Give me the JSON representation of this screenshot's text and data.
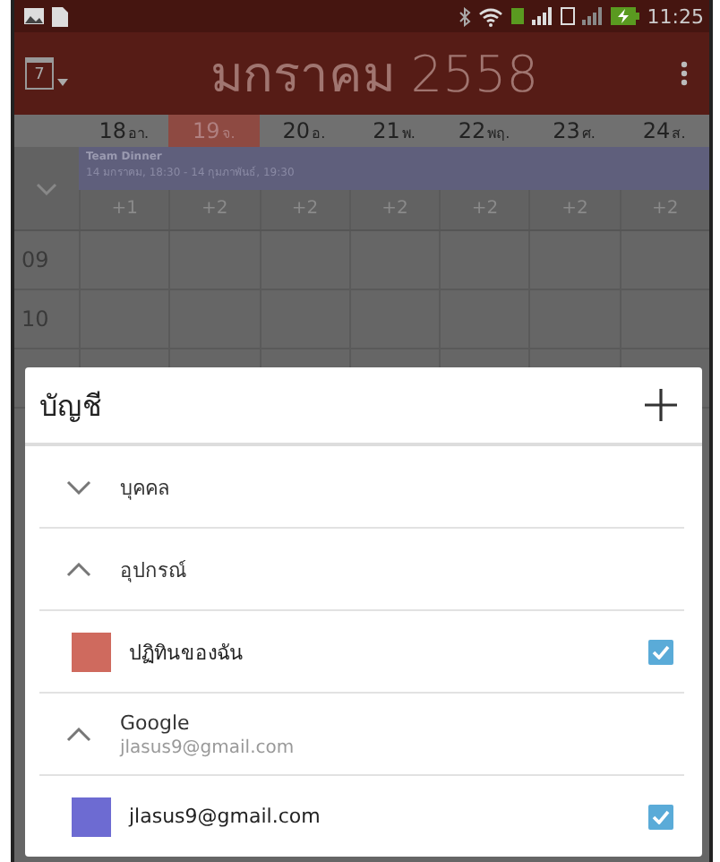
{
  "status_bar": {
    "time": "11:25"
  },
  "app_bar": {
    "calendar_icon_day": "7",
    "title": "มกราคม 2558"
  },
  "days": [
    {
      "date": "18",
      "weekday": "อา.",
      "selected": false
    },
    {
      "date": "19",
      "weekday": "จ.",
      "selected": true
    },
    {
      "date": "20",
      "weekday": "อ.",
      "selected": false
    },
    {
      "date": "21",
      "weekday": "พ.",
      "selected": false
    },
    {
      "date": "22",
      "weekday": "พฤ.",
      "selected": false
    },
    {
      "date": "23",
      "weekday": "ศ.",
      "selected": false
    },
    {
      "date": "24",
      "weekday": "ส.",
      "selected": false
    }
  ],
  "all_day_event": {
    "title": "Team Dinner",
    "time": "14 มกราคม, 18:30 - 14 กุมภาพันธ์, 19:30"
  },
  "more_counts": [
    "+1",
    "+2",
    "+2",
    "+2",
    "+2",
    "+2",
    "+2"
  ],
  "hours": [
    "09",
    "10"
  ],
  "dialog": {
    "title": "บัญชี",
    "items": [
      {
        "kind": "group",
        "label": "บุคคล",
        "expanded": false
      },
      {
        "kind": "group",
        "label": "อุปกรณ์",
        "expanded": true
      },
      {
        "kind": "calendar",
        "label": "ปฏิทินของฉัน",
        "color": "#cf6a5e",
        "checked": true
      },
      {
        "kind": "group",
        "label": "Google",
        "sublabel": "jlasus9@gmail.com",
        "expanded": true
      },
      {
        "kind": "calendar",
        "label": "jlasus9@gmail.com",
        "color": "#6d6bd2",
        "checked": true
      }
    ]
  }
}
